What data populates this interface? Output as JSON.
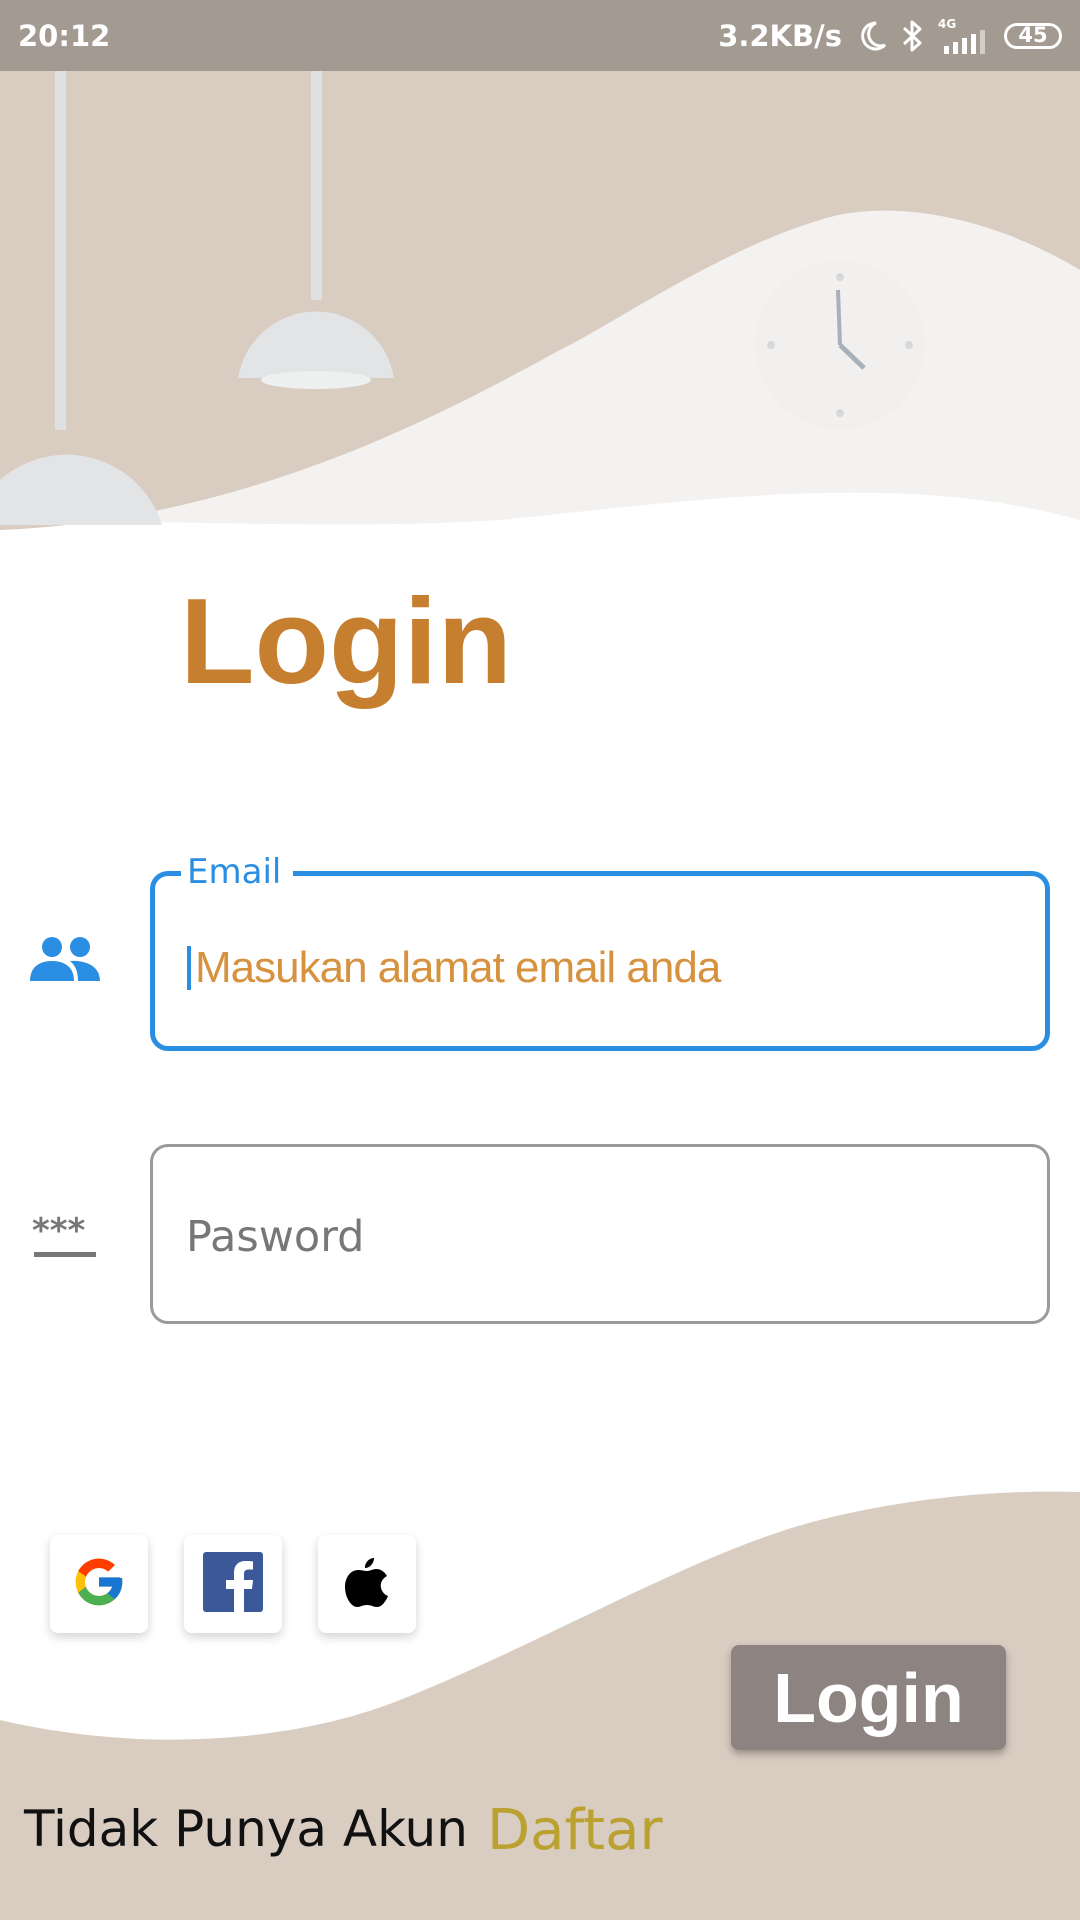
{
  "status_bar": {
    "time": "20:12",
    "net_speed": "3.2KB/s",
    "network_type": "4G",
    "battery": "45",
    "icons": [
      "moon-icon",
      "bluetooth-icon",
      "signal-icon",
      "battery-icon"
    ]
  },
  "colors": {
    "background_beige": "#d9cdc2",
    "accent_blue": "#2a8ee3",
    "title_orange": "#c67f2e",
    "placeholder_orange": "#d6923f",
    "login_button": "#8d8380",
    "link_gold": "#bba12f"
  },
  "page": {
    "title": "Login"
  },
  "email_field": {
    "label": "Email",
    "placeholder": "Masukan alamat email anda",
    "icon": "people-icon"
  },
  "password_field": {
    "placeholder": "Pasword",
    "icon": "password-icon"
  },
  "social_logins": [
    {
      "name": "google",
      "icon": "google-icon"
    },
    {
      "name": "facebook",
      "icon": "facebook-icon"
    },
    {
      "name": "apple",
      "icon": "apple-icon"
    }
  ],
  "login_button": {
    "label": "Login"
  },
  "footer": {
    "prompt": "Tidak Punya Akun",
    "register_link": "Daftar"
  }
}
